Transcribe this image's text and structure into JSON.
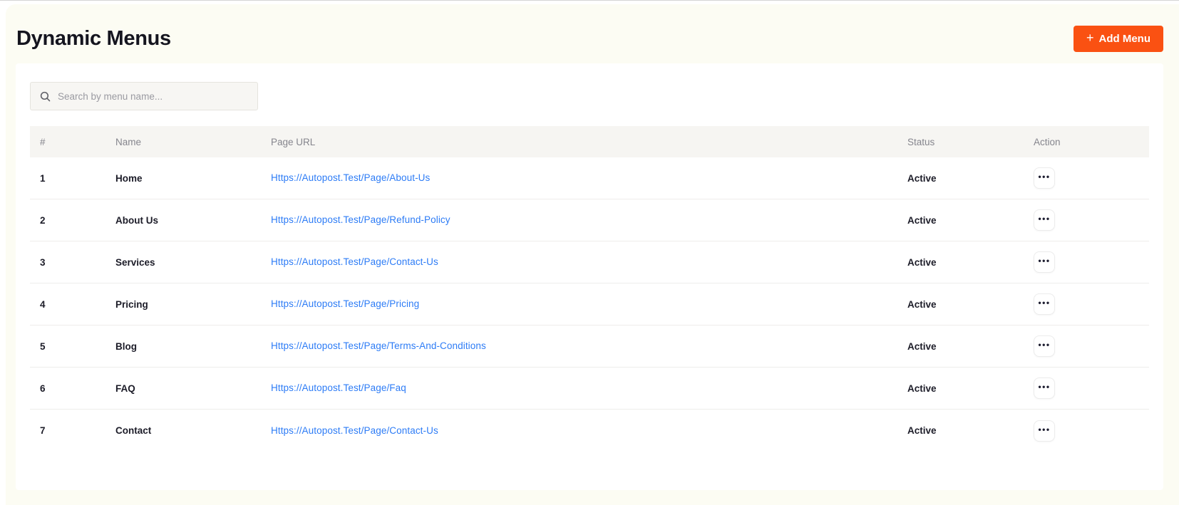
{
  "page": {
    "title": "Dynamic Menus"
  },
  "header": {
    "add_menu_button": "Add Menu",
    "plus_glyph": "+"
  },
  "search": {
    "placeholder": "Search by menu name...",
    "icon": "search"
  },
  "icons": {
    "ellipsis": "•••"
  },
  "table": {
    "columns": [
      "#",
      "Name",
      "Page URL",
      "Status",
      "Action"
    ],
    "rows": [
      {
        "index": "1",
        "name": "Home",
        "url": "Https://Autopost.Test/Page/About-Us",
        "status": "Active"
      },
      {
        "index": "2",
        "name": "About Us",
        "url": "Https://Autopost.Test/Page/Refund-Policy",
        "status": "Active"
      },
      {
        "index": "3",
        "name": "Services",
        "url": "Https://Autopost.Test/Page/Contact-Us",
        "status": "Active"
      },
      {
        "index": "4",
        "name": "Pricing",
        "url": "Https://Autopost.Test/Page/Pricing",
        "status": "Active"
      },
      {
        "index": "5",
        "name": "Blog",
        "url": "Https://Autopost.Test/Page/Terms-And-Conditions",
        "status": "Active"
      },
      {
        "index": "6",
        "name": "FAQ",
        "url": "Https://Autopost.Test/Page/Faq",
        "status": "Active"
      },
      {
        "index": "7",
        "name": "Contact",
        "url": "Https://Autopost.Test/Page/Contact-Us",
        "status": "Active"
      }
    ]
  },
  "colors": {
    "accent": "#fa5112",
    "link": "#2d7cf6",
    "page_background": "#fcfcf3",
    "card_background": "#ffffff",
    "table_header_background": "#f6f5f2",
    "text_dark": "#1c1c28",
    "text_muted": "#85858d"
  }
}
